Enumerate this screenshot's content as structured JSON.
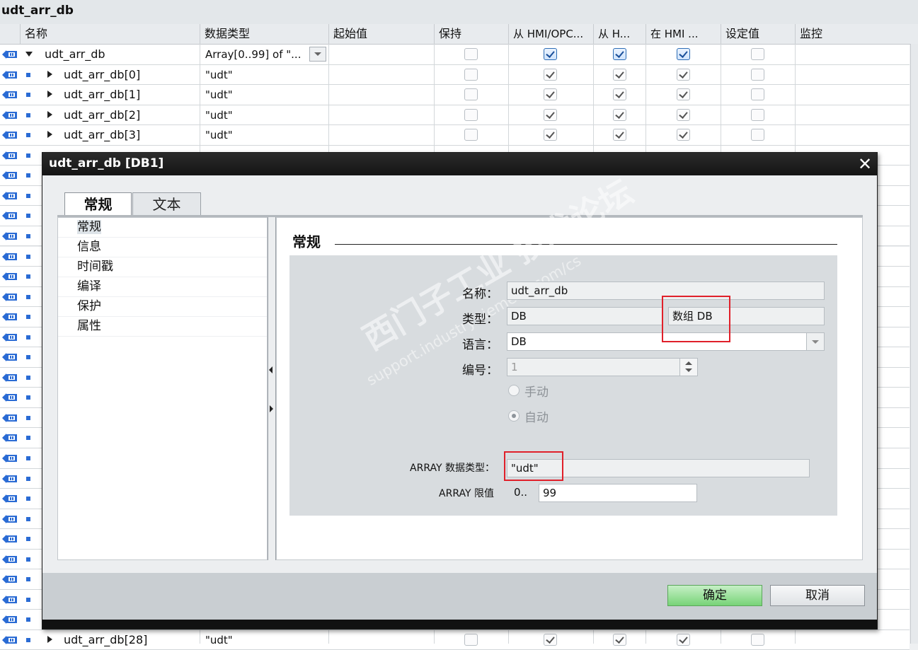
{
  "editor": {
    "title": "udt_arr_db",
    "columns": [
      "名称",
      "数据类型",
      "起始值",
      "保持",
      "从 HMI/OPC...",
      "从 H...",
      "在 HMI ...",
      "设定值",
      "监控"
    ],
    "rows": [
      {
        "name": "udt_arr_db",
        "type": "Array[0..99] of \"...",
        "expanded": true
      },
      {
        "name": "udt_arr_db[0]",
        "type": "\"udt\""
      },
      {
        "name": "udt_arr_db[1]",
        "type": "\"udt\""
      },
      {
        "name": "udt_arr_db[2]",
        "type": "\"udt\""
      },
      {
        "name": "udt_arr_db[3]",
        "type": "\"udt\""
      },
      {
        "name": "udt_arr_db[28]",
        "type": "\"udt\""
      }
    ]
  },
  "dialog": {
    "title": "udt_arr_db [DB1]",
    "close": "✕",
    "tabs": [
      "常规",
      "文本"
    ],
    "nav": [
      "常规",
      "信息",
      "时间戳",
      "编译",
      "保护",
      "属性"
    ],
    "section_title": "常规",
    "fields": {
      "name_label": "名称：",
      "name_value": "udt_arr_db",
      "type_label": "类型：",
      "type_value": "DB",
      "type_extra": "数组 DB",
      "language_label": "语言：",
      "language_value": "DB",
      "number_label": "编号：",
      "number_value": "1",
      "manual_label": "手动",
      "auto_label": "自动",
      "array_type_label": "ARRAY 数据类型：",
      "array_type_value": "\"udt\"",
      "array_limit_label": "ARRAY 限值",
      "array_limit_lower": "0..",
      "array_limit_upper": "99"
    },
    "watermark": "西门子工业 技术论坛",
    "watermark_sub": "support.industry.siemens.com/cs",
    "ok": "确定",
    "cancel": "取消"
  }
}
